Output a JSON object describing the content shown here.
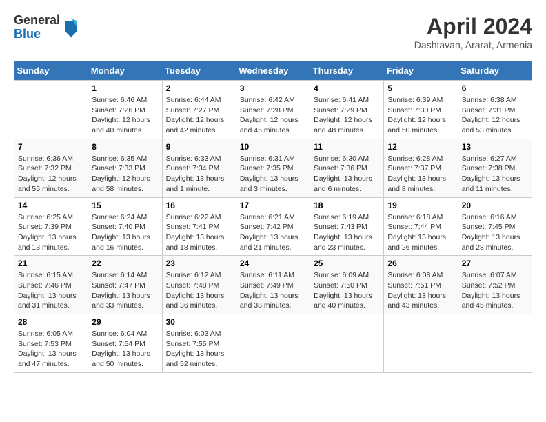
{
  "header": {
    "logo_general": "General",
    "logo_blue": "Blue",
    "month_title": "April 2024",
    "location": "Dashtavan, Ararat, Armenia"
  },
  "days_of_week": [
    "Sunday",
    "Monday",
    "Tuesday",
    "Wednesday",
    "Thursday",
    "Friday",
    "Saturday"
  ],
  "weeks": [
    [
      {
        "num": "",
        "sunrise": "",
        "sunset": "",
        "daylight": ""
      },
      {
        "num": "1",
        "sunrise": "Sunrise: 6:46 AM",
        "sunset": "Sunset: 7:26 PM",
        "daylight": "Daylight: 12 hours and 40 minutes."
      },
      {
        "num": "2",
        "sunrise": "Sunrise: 6:44 AM",
        "sunset": "Sunset: 7:27 PM",
        "daylight": "Daylight: 12 hours and 42 minutes."
      },
      {
        "num": "3",
        "sunrise": "Sunrise: 6:42 AM",
        "sunset": "Sunset: 7:28 PM",
        "daylight": "Daylight: 12 hours and 45 minutes."
      },
      {
        "num": "4",
        "sunrise": "Sunrise: 6:41 AM",
        "sunset": "Sunset: 7:29 PM",
        "daylight": "Daylight: 12 hours and 48 minutes."
      },
      {
        "num": "5",
        "sunrise": "Sunrise: 6:39 AM",
        "sunset": "Sunset: 7:30 PM",
        "daylight": "Daylight: 12 hours and 50 minutes."
      },
      {
        "num": "6",
        "sunrise": "Sunrise: 6:38 AM",
        "sunset": "Sunset: 7:31 PM",
        "daylight": "Daylight: 12 hours and 53 minutes."
      }
    ],
    [
      {
        "num": "7",
        "sunrise": "Sunrise: 6:36 AM",
        "sunset": "Sunset: 7:32 PM",
        "daylight": "Daylight: 12 hours and 55 minutes."
      },
      {
        "num": "8",
        "sunrise": "Sunrise: 6:35 AM",
        "sunset": "Sunset: 7:33 PM",
        "daylight": "Daylight: 12 hours and 58 minutes."
      },
      {
        "num": "9",
        "sunrise": "Sunrise: 6:33 AM",
        "sunset": "Sunset: 7:34 PM",
        "daylight": "Daylight: 13 hours and 1 minute."
      },
      {
        "num": "10",
        "sunrise": "Sunrise: 6:31 AM",
        "sunset": "Sunset: 7:35 PM",
        "daylight": "Daylight: 13 hours and 3 minutes."
      },
      {
        "num": "11",
        "sunrise": "Sunrise: 6:30 AM",
        "sunset": "Sunset: 7:36 PM",
        "daylight": "Daylight: 13 hours and 6 minutes."
      },
      {
        "num": "12",
        "sunrise": "Sunrise: 6:28 AM",
        "sunset": "Sunset: 7:37 PM",
        "daylight": "Daylight: 13 hours and 8 minutes."
      },
      {
        "num": "13",
        "sunrise": "Sunrise: 6:27 AM",
        "sunset": "Sunset: 7:38 PM",
        "daylight": "Daylight: 13 hours and 11 minutes."
      }
    ],
    [
      {
        "num": "14",
        "sunrise": "Sunrise: 6:25 AM",
        "sunset": "Sunset: 7:39 PM",
        "daylight": "Daylight: 13 hours and 13 minutes."
      },
      {
        "num": "15",
        "sunrise": "Sunrise: 6:24 AM",
        "sunset": "Sunset: 7:40 PM",
        "daylight": "Daylight: 13 hours and 16 minutes."
      },
      {
        "num": "16",
        "sunrise": "Sunrise: 6:22 AM",
        "sunset": "Sunset: 7:41 PM",
        "daylight": "Daylight: 13 hours and 18 minutes."
      },
      {
        "num": "17",
        "sunrise": "Sunrise: 6:21 AM",
        "sunset": "Sunset: 7:42 PM",
        "daylight": "Daylight: 13 hours and 21 minutes."
      },
      {
        "num": "18",
        "sunrise": "Sunrise: 6:19 AM",
        "sunset": "Sunset: 7:43 PM",
        "daylight": "Daylight: 13 hours and 23 minutes."
      },
      {
        "num": "19",
        "sunrise": "Sunrise: 6:18 AM",
        "sunset": "Sunset: 7:44 PM",
        "daylight": "Daylight: 13 hours and 26 minutes."
      },
      {
        "num": "20",
        "sunrise": "Sunrise: 6:16 AM",
        "sunset": "Sunset: 7:45 PM",
        "daylight": "Daylight: 13 hours and 28 minutes."
      }
    ],
    [
      {
        "num": "21",
        "sunrise": "Sunrise: 6:15 AM",
        "sunset": "Sunset: 7:46 PM",
        "daylight": "Daylight: 13 hours and 31 minutes."
      },
      {
        "num": "22",
        "sunrise": "Sunrise: 6:14 AM",
        "sunset": "Sunset: 7:47 PM",
        "daylight": "Daylight: 13 hours and 33 minutes."
      },
      {
        "num": "23",
        "sunrise": "Sunrise: 6:12 AM",
        "sunset": "Sunset: 7:48 PM",
        "daylight": "Daylight: 13 hours and 36 minutes."
      },
      {
        "num": "24",
        "sunrise": "Sunrise: 6:11 AM",
        "sunset": "Sunset: 7:49 PM",
        "daylight": "Daylight: 13 hours and 38 minutes."
      },
      {
        "num": "25",
        "sunrise": "Sunrise: 6:09 AM",
        "sunset": "Sunset: 7:50 PM",
        "daylight": "Daylight: 13 hours and 40 minutes."
      },
      {
        "num": "26",
        "sunrise": "Sunrise: 6:08 AM",
        "sunset": "Sunset: 7:51 PM",
        "daylight": "Daylight: 13 hours and 43 minutes."
      },
      {
        "num": "27",
        "sunrise": "Sunrise: 6:07 AM",
        "sunset": "Sunset: 7:52 PM",
        "daylight": "Daylight: 13 hours and 45 minutes."
      }
    ],
    [
      {
        "num": "28",
        "sunrise": "Sunrise: 6:05 AM",
        "sunset": "Sunset: 7:53 PM",
        "daylight": "Daylight: 13 hours and 47 minutes."
      },
      {
        "num": "29",
        "sunrise": "Sunrise: 6:04 AM",
        "sunset": "Sunset: 7:54 PM",
        "daylight": "Daylight: 13 hours and 50 minutes."
      },
      {
        "num": "30",
        "sunrise": "Sunrise: 6:03 AM",
        "sunset": "Sunset: 7:55 PM",
        "daylight": "Daylight: 13 hours and 52 minutes."
      },
      {
        "num": "",
        "sunrise": "",
        "sunset": "",
        "daylight": ""
      },
      {
        "num": "",
        "sunrise": "",
        "sunset": "",
        "daylight": ""
      },
      {
        "num": "",
        "sunrise": "",
        "sunset": "",
        "daylight": ""
      },
      {
        "num": "",
        "sunrise": "",
        "sunset": "",
        "daylight": ""
      }
    ]
  ]
}
